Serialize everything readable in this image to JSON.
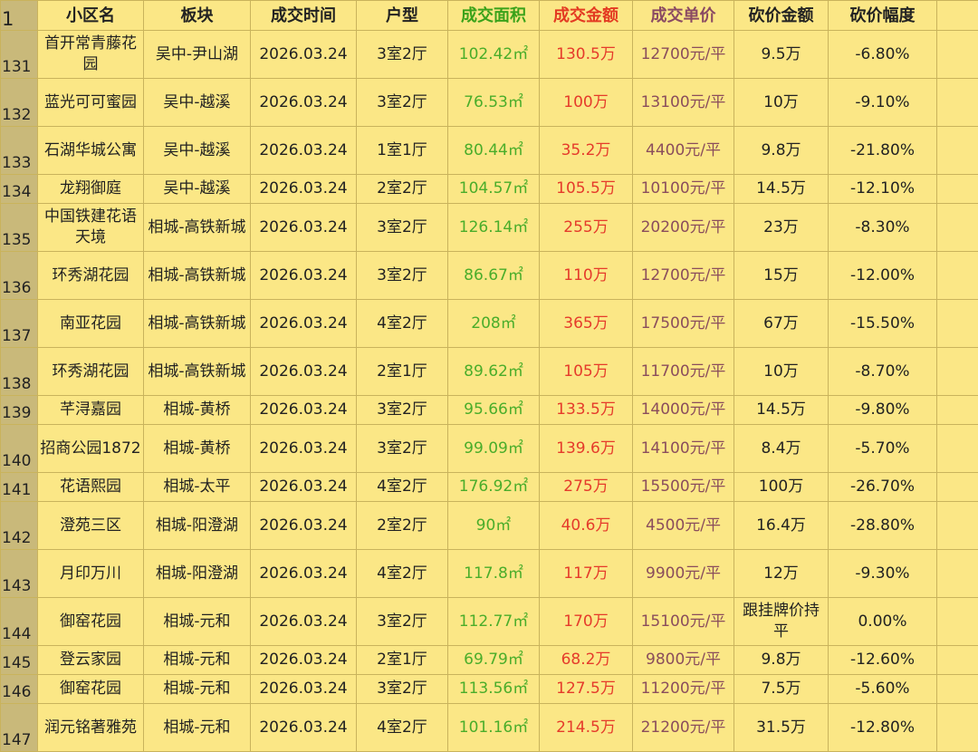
{
  "header": {
    "row_number": "1",
    "columns": [
      "小区名",
      "板块",
      "成交时间",
      "户型",
      "成交面积",
      "成交金额",
      "成交单价",
      "砍价金额",
      "砍价幅度"
    ]
  },
  "rows": [
    {
      "n": "131",
      "name": "首开常青藤花园",
      "area_block": "吴中-尹山湖",
      "date": "2026.03.24",
      "layout": "3室2厅",
      "size": "102.42㎡",
      "total": "130.5万",
      "unit": "12700元/平",
      "cut": "9.5万",
      "pct": "-6.80%"
    },
    {
      "n": "132",
      "name": "蓝光可可蜜园",
      "area_block": "吴中-越溪",
      "date": "2026.03.24",
      "layout": "3室2厅",
      "size": "76.53㎡",
      "total": "100万",
      "unit": "13100元/平",
      "cut": "10万",
      "pct": "-9.10%"
    },
    {
      "n": "133",
      "name": "石湖华城公寓",
      "area_block": "吴中-越溪",
      "date": "2026.03.24",
      "layout": "1室1厅",
      "size": "80.44㎡",
      "total": "35.2万",
      "unit": "4400元/平",
      "cut": "9.8万",
      "pct": "-21.80%"
    },
    {
      "n": "134",
      "name": "龙翔御庭",
      "area_block": "吴中-越溪",
      "date": "2026.03.24",
      "layout": "2室2厅",
      "size": "104.57㎡",
      "total": "105.5万",
      "unit": "10100元/平",
      "cut": "14.5万",
      "pct": "-12.10%"
    },
    {
      "n": "135",
      "name": "中国铁建花语天境",
      "area_block": "相城-高铁新城",
      "date": "2026.03.24",
      "layout": "3室2厅",
      "size": "126.14㎡",
      "total": "255万",
      "unit": "20200元/平",
      "cut": "23万",
      "pct": "-8.30%"
    },
    {
      "n": "136",
      "name": "环秀湖花园",
      "area_block": "相城-高铁新城",
      "date": "2026.03.24",
      "layout": "3室2厅",
      "size": "86.67㎡",
      "total": "110万",
      "unit": "12700元/平",
      "cut": "15万",
      "pct": "-12.00%"
    },
    {
      "n": "137",
      "name": "南亚花园",
      "area_block": "相城-高铁新城",
      "date": "2026.03.24",
      "layout": "4室2厅",
      "size": "208㎡",
      "total": "365万",
      "unit": "17500元/平",
      "cut": "67万",
      "pct": "-15.50%"
    },
    {
      "n": "138",
      "name": "环秀湖花园",
      "area_block": "相城-高铁新城",
      "date": "2026.03.24",
      "layout": "2室1厅",
      "size": "89.62㎡",
      "total": "105万",
      "unit": "11700元/平",
      "cut": "10万",
      "pct": "-8.70%"
    },
    {
      "n": "139",
      "name": "芊浔嘉园",
      "area_block": "相城-黄桥",
      "date": "2026.03.24",
      "layout": "3室2厅",
      "size": "95.66㎡",
      "total": "133.5万",
      "unit": "14000元/平",
      "cut": "14.5万",
      "pct": "-9.80%"
    },
    {
      "n": "140",
      "name": "招商公园1872",
      "area_block": "相城-黄桥",
      "date": "2026.03.24",
      "layout": "3室2厅",
      "size": "99.09㎡",
      "total": "139.6万",
      "unit": "14100元/平",
      "cut": "8.4万",
      "pct": "-5.70%"
    },
    {
      "n": "141",
      "name": "花语熙园",
      "area_block": "相城-太平",
      "date": "2026.03.24",
      "layout": "4室2厅",
      "size": "176.92㎡",
      "total": "275万",
      "unit": "15500元/平",
      "cut": "100万",
      "pct": "-26.70%"
    },
    {
      "n": "142",
      "name": "澄苑三区",
      "area_block": "相城-阳澄湖",
      "date": "2026.03.24",
      "layout": "2室2厅",
      "size": "90㎡",
      "total": "40.6万",
      "unit": "4500元/平",
      "cut": "16.4万",
      "pct": "-28.80%"
    },
    {
      "n": "143",
      "name": "月印万川",
      "area_block": "相城-阳澄湖",
      "date": "2026.03.24",
      "layout": "4室2厅",
      "size": "117.8㎡",
      "total": "117万",
      "unit": "9900元/平",
      "cut": "12万",
      "pct": "-9.30%"
    },
    {
      "n": "144",
      "name": "御窑花园",
      "area_block": "相城-元和",
      "date": "2026.03.24",
      "layout": "3室2厅",
      "size": "112.77㎡",
      "total": "170万",
      "unit": "15100元/平",
      "cut": "跟挂牌价持平",
      "pct": "0.00%"
    },
    {
      "n": "145",
      "name": "登云家园",
      "area_block": "相城-元和",
      "date": "2026.03.24",
      "layout": "2室1厅",
      "size": "69.79㎡",
      "total": "68.2万",
      "unit": "9800元/平",
      "cut": "9.8万",
      "pct": "-12.60%"
    },
    {
      "n": "146",
      "name": "御窑花园",
      "area_block": "相城-元和",
      "date": "2026.03.24",
      "layout": "3室2厅",
      "size": "113.56㎡",
      "total": "127.5万",
      "unit": "11200元/平",
      "cut": "7.5万",
      "pct": "-5.60%"
    },
    {
      "n": "147",
      "name": "润元铭著雅苑",
      "area_block": "相城-元和",
      "date": "2026.03.24",
      "layout": "4室2厅",
      "size": "101.16㎡",
      "total": "214.5万",
      "unit": "21200元/平",
      "cut": "31.5万",
      "pct": "-12.80%"
    }
  ]
}
